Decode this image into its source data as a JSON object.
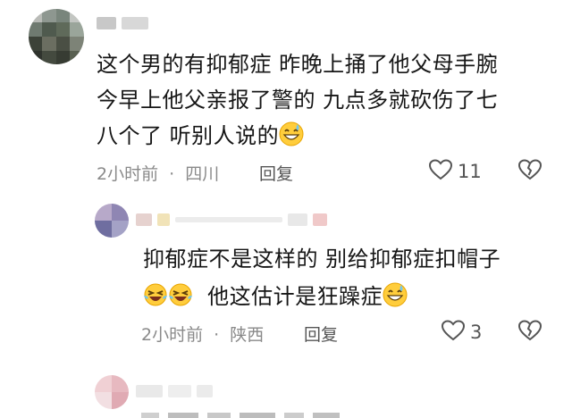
{
  "comment1": {
    "lines": [
      "这个男的有抑郁症 昨晚上捅了他父母手腕",
      "今早上他父亲报了警的 九点多就砍伤了七",
      "八个了 听别人说的"
    ],
    "emoji": "grinning-sweat-emoji",
    "time": "2小时前",
    "separator": "·",
    "location": "四川",
    "reply_label": "回复",
    "like_count": "11"
  },
  "comment2": {
    "line1": "抑郁症不是这样的 别给抑郁症扣帽子",
    "line2": "他这估计是狂躁症",
    "emojis_before": [
      "laughing-tears-emoji",
      "laughing-tears-emoji"
    ],
    "emoji_after": "grinning-sweat-emoji",
    "time": "2小时前",
    "separator": "·",
    "location": "陕西",
    "reply_label": "回复",
    "like_count": "3"
  },
  "icons": {
    "like": "heart-outline-icon",
    "dislike": "broken-heart-icon"
  }
}
